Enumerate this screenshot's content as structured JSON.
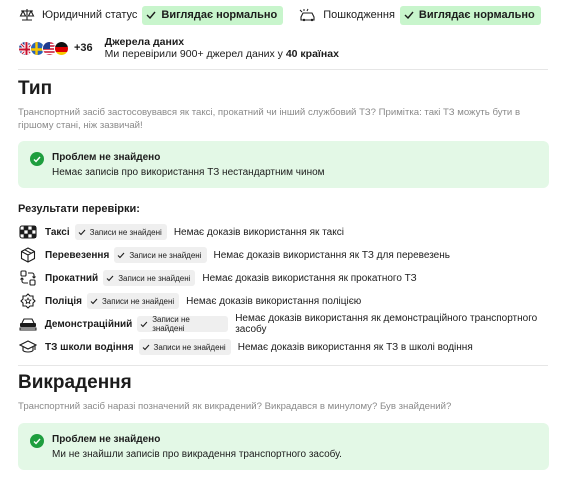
{
  "top_status": [
    {
      "icon": "legal-scales-icon",
      "label": "Юридичний статус",
      "value": "Виглядає нормально"
    },
    {
      "icon": "damage-car-icon",
      "label": "Пошкодження",
      "value": "Виглядає нормально"
    }
  ],
  "sources": {
    "flags": [
      "uk-flag",
      "sweden-flag",
      "usa-flag",
      "germany-flag"
    ],
    "more": "+36",
    "title": "Джерела даних",
    "text_prefix": "Ми перевірили 900+ джерел даних у ",
    "text_bold": "40 країнах"
  },
  "type_section": {
    "title": "Тип",
    "description": "Транспортний засіб застосовувався як таксі, прокатний чи інший службовий ТЗ? Примітка: такі ТЗ можуть бути в гіршому стані, ніж зазвичай!",
    "card_title": "Проблем не знайдено",
    "card_text": "Немає записів про використання ТЗ нестандартним чином",
    "results_title": "Результати перевірки:",
    "results": [
      {
        "icon": "taxi-icon",
        "name": "Таксі",
        "chip": "Записи не знайдені",
        "text": "Немає доказів використання як таксі"
      },
      {
        "icon": "box-icon",
        "name": "Перевезення",
        "chip": "Записи не знайдені",
        "text": "Немає доказів використання як ТЗ для перевезень"
      },
      {
        "icon": "rental-swap-icon",
        "name": "Прокатний",
        "chip": "Записи не знайдені",
        "text": "Немає доказів використання як прокатного ТЗ"
      },
      {
        "icon": "police-badge-icon",
        "name": "Поліція",
        "chip": "Записи не знайдені",
        "text": "Немає доказів використання поліцією"
      },
      {
        "icon": "demo-car-icon",
        "name": "Демонстраційний",
        "chip": "Записи не знайдені",
        "text": "Немає доказів використання як демонстраційного транспортного засобу"
      },
      {
        "icon": "graduation-cap-icon",
        "name": "ТЗ школи водіння",
        "chip": "Записи не знайдені",
        "text": "Немає доказів використання як ТЗ в школі водіння"
      }
    ]
  },
  "theft_section": {
    "title": "Викрадення",
    "description": "Транспортний засіб наразі позначений як викрадений? Викрадався в минулому? Був знайдений?",
    "card_title": "Проблем не знайдено",
    "card_text": "Ми не знайшли записів про викрадення транспортного засобу."
  },
  "colors": {
    "ok_pill": "#c8f5cc",
    "ok_card": "#e3f8e6",
    "check": "#1e9e3e",
    "chip": "#efefef"
  }
}
